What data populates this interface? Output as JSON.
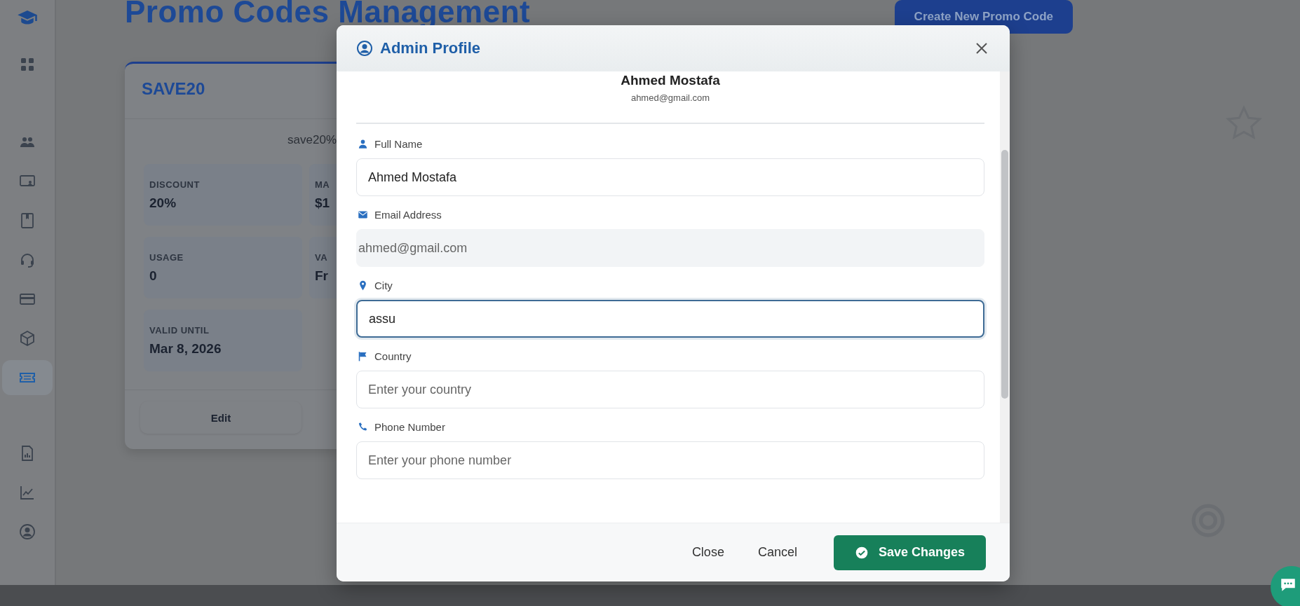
{
  "sidebar": {
    "items": [
      {
        "selected": false
      },
      {
        "selected": false
      },
      {
        "selected": false
      },
      {
        "selected": false
      },
      {
        "selected": false
      },
      {
        "selected": false
      },
      {
        "selected": false
      },
      {
        "selected": true
      },
      {
        "selected": false
      },
      {
        "selected": false
      },
      {
        "selected": false
      }
    ]
  },
  "page": {
    "title": "Promo Codes Management",
    "create_button": "Create New Promo Code"
  },
  "card": {
    "code": "SAVE20",
    "description": "save20%",
    "stats": [
      {
        "label": "DISCOUNT",
        "value": "20%"
      },
      {
        "label": "MA",
        "value": "$1"
      },
      {
        "label": "USAGE",
        "value": "0"
      },
      {
        "label": "VA",
        "value": "Fr"
      },
      {
        "label": "VALID UNTIL",
        "value": "Mar 8, 2026"
      }
    ],
    "actions": [
      "Edit"
    ]
  },
  "modal": {
    "title": "Admin Profile",
    "name": "Ahmed Mostafa",
    "email": "ahmed@gmail.com",
    "fields": [
      {
        "label": "Full Name",
        "value": "Ahmed Mostafa",
        "disabled": false,
        "focused": false
      },
      {
        "label": "Email Address",
        "value": "ahmed@gmail.com",
        "disabled": true,
        "focused": false
      },
      {
        "label": "City",
        "value": "assu",
        "disabled": false,
        "focused": true
      },
      {
        "label": "Country",
        "placeholder": "Enter your country",
        "disabled": false,
        "focused": false
      },
      {
        "label": "Phone Number",
        "placeholder": "Enter your phone number",
        "disabled": false,
        "focused": false
      }
    ],
    "buttons": [
      {
        "label": "Close",
        "kind": "link"
      },
      {
        "label": "Cancel",
        "kind": "link"
      },
      {
        "label": "Save Changes",
        "kind": "primary"
      }
    ]
  }
}
